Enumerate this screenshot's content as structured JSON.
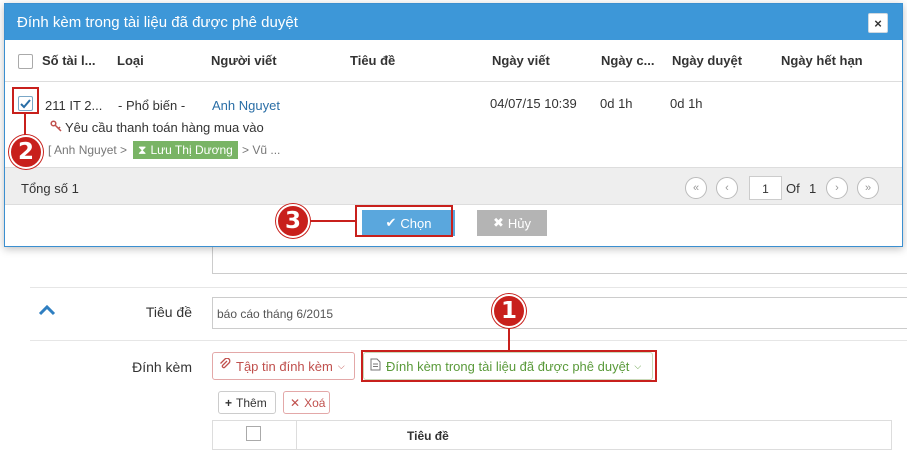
{
  "dialog": {
    "title": "Đính kèm trong tài liệu đã được phê duyệt",
    "close_label": "×",
    "columns": [
      "Số tài l...",
      "Loại",
      "Người viết",
      "Tiêu đề",
      "Ngày viết",
      "Ngày c...",
      "Ngày duyệt",
      "Ngày hết hạn"
    ],
    "row": {
      "number": "211 IT 2...",
      "type": "- Phổ biến -",
      "author": "Anh Nguyet",
      "written_date": "04/07/15 10:39",
      "col6": "0d 1h",
      "approved": "0d 1h",
      "subject": "Yêu cầu thanh toán hàng mua vào",
      "workflow_start": "[ Anh Nguyet >",
      "workflow_current": "Lưu Thị Dương",
      "workflow_end": "> Vũ ..."
    },
    "footer": {
      "total": "Tổng số 1",
      "page_input": "1",
      "of_label": "Of",
      "total_pages": "1"
    },
    "choose_label": "Chọn",
    "cancel_label": "Hủy"
  },
  "form": {
    "title_label": "Tiêu đề",
    "title_value": "báo cáo tháng 6/2015",
    "attach_label": "Đính kèm",
    "attach_file_btn": "Tập tin đính kèm",
    "attach_approved_btn": "Đính kèm trong tài liệu đã được phê duyệt",
    "add_btn": "Thêm",
    "delete_btn": "Xoá",
    "table_col_title": "Tiêu đề"
  },
  "annotations": [
    "1",
    "2",
    "3"
  ],
  "colors": {
    "header_blue": "#3d97d8",
    "annotation_red": "#c8201c",
    "chip_green": "#79b465",
    "link_blue": "#2a6ea6"
  }
}
